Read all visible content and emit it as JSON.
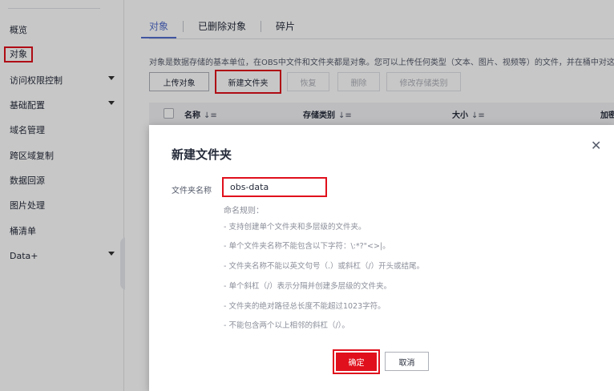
{
  "sidebar": {
    "items": [
      {
        "label": "概览",
        "expandable": false
      },
      {
        "label": "对象",
        "expandable": false,
        "active": true
      },
      {
        "label": "访问权限控制",
        "expandable": true
      },
      {
        "label": "基础配置",
        "expandable": true
      },
      {
        "label": "域名管理",
        "expandable": false
      },
      {
        "label": "跨区域复制",
        "expandable": false
      },
      {
        "label": "数据回源",
        "expandable": false
      },
      {
        "label": "图片处理",
        "expandable": false
      },
      {
        "label": "桶清单",
        "expandable": false
      },
      {
        "label": "Data+",
        "expandable": true
      }
    ]
  },
  "tabs": [
    {
      "label": "对象",
      "active": true
    },
    {
      "label": "已删除对象",
      "active": false
    },
    {
      "label": "碎片",
      "active": false
    }
  ],
  "description": "对象是数据存储的基本单位，在OBS中文件和文件夹都是对象。您可以上传任何类型（文本、图片、视频等）的文件，并在桶中对这些",
  "toolbar": {
    "upload": "上传对象",
    "new_folder": "新建文件夹",
    "restore": "恢复",
    "delete": "删除",
    "change_storage": "修改存储类别"
  },
  "table": {
    "columns": [
      "名称",
      "存储类别",
      "大小",
      "加密"
    ]
  },
  "dialog": {
    "title": "新建文件夹",
    "field_label": "文件夹名称",
    "field_value": "obs-data",
    "rules_title": "命名规则：",
    "rules": [
      "- 支持创建单个文件夹和多层级的文件夹。",
      "- 单个文件夹名称不能包含以下字符：\\:*?\"<>|。",
      "- 文件夹名称不能以英文句号（.）或斜杠（/）开头或结尾。",
      "- 单个斜杠（/）表示分隔并创建多层级的文件夹。",
      "- 文件夹的绝对路径总长度不能超过1023字符。",
      "- 不能包含两个以上相邻的斜杠（/）。"
    ],
    "confirm": "确定",
    "cancel": "取消"
  },
  "colors": {
    "highlight": "#e0101c",
    "accent": "#526ecc"
  }
}
